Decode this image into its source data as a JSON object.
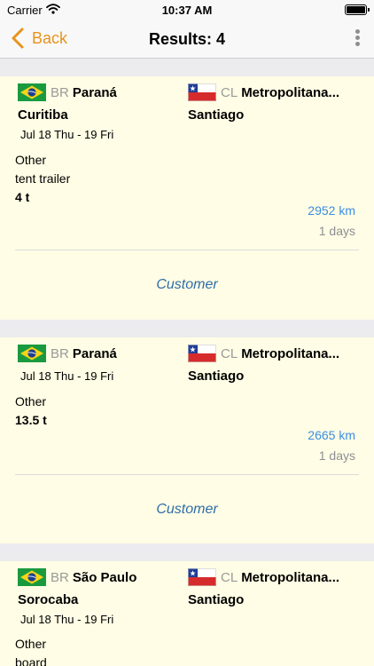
{
  "status_bar": {
    "carrier": "Carrier",
    "time": "10:37 AM"
  },
  "nav": {
    "back_label": "Back",
    "title": "Results: 4"
  },
  "colors": {
    "accent": "#e8931d",
    "link": "#3a8ee4",
    "customer": "#2f6da8",
    "card_bg": "#fffde5"
  },
  "results": [
    {
      "from": {
        "code": "BR",
        "region": "Paraná",
        "city": "Curitiba",
        "dates": "Jul 18 Thu - 19 Fri"
      },
      "to": {
        "code": "CL",
        "region": "Metropolitana...",
        "city": "Santiago"
      },
      "cargo": [
        "Other",
        "tent trailer"
      ],
      "weight": "4 t",
      "distance": "2952 km",
      "duration": "1 days",
      "customer_label": "Customer"
    },
    {
      "from": {
        "code": "BR",
        "region": "Paraná",
        "dates": "Jul 18 Thu - 19 Fri"
      },
      "to": {
        "code": "CL",
        "region": "Metropolitana...",
        "city": "Santiago"
      },
      "cargo": [
        "Other"
      ],
      "weight": "13.5 t",
      "distance": "2665 km",
      "duration": "1 days",
      "customer_label": "Customer"
    },
    {
      "from": {
        "code": "BR",
        "region": "São Paulo",
        "city": "Sorocaba",
        "dates": "Jul 18 Thu - 19 Fri"
      },
      "to": {
        "code": "CL",
        "region": "Metropolitana...",
        "city": "Santiago"
      },
      "cargo": [
        "Other",
        "board"
      ]
    }
  ]
}
